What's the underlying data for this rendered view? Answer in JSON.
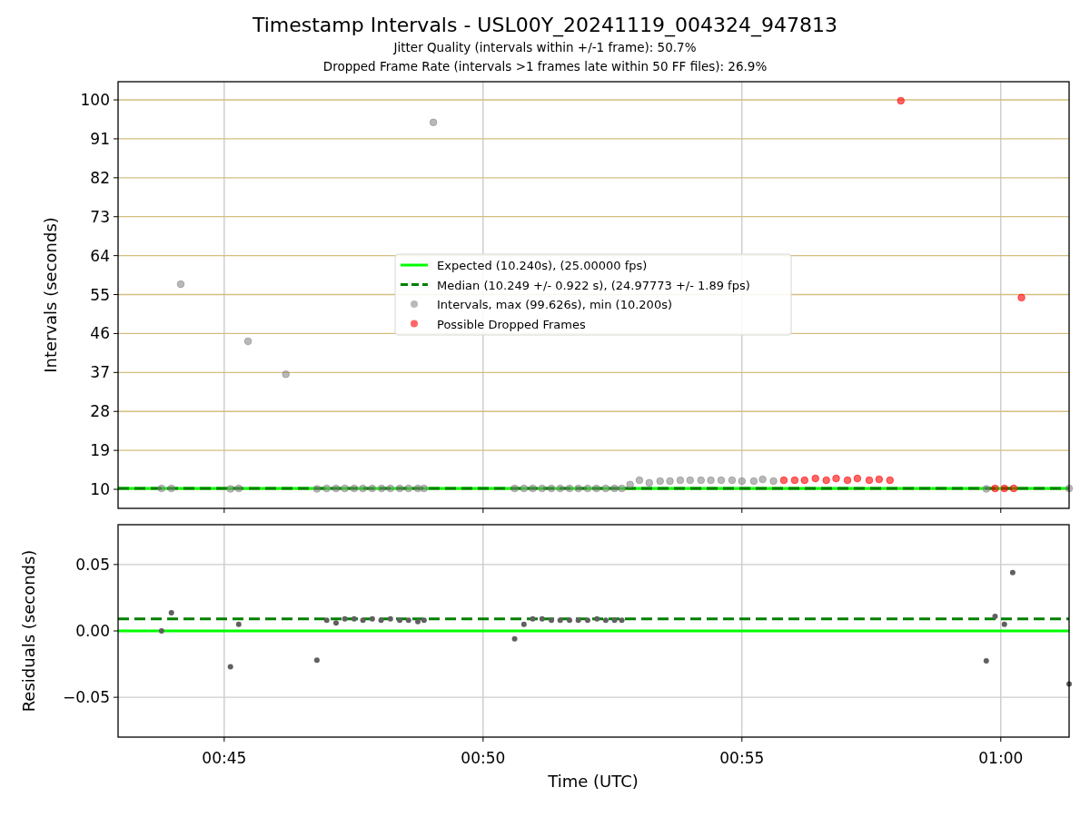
{
  "figure": {
    "title": "Timestamp Intervals - USL00Y_20241119_004324_947813",
    "subtitles": [
      "Jitter Quality (intervals within +/-1 frame): 50.7%",
      "Dropped Frame Rate (intervals >1 frames late within 50 FF files): 26.9%"
    ]
  },
  "charts": [
    {
      "chart_data": {
        "type": "scatter",
        "ylabel": "Intervals (seconds)",
        "xlim": [
          42.95,
          61.32
        ],
        "ylim": [
          5.6,
          104.2
        ],
        "grid": true,
        "legend": "center",
        "yticks": [
          {
            "value": 10,
            "label": "10"
          },
          {
            "value": 19,
            "label": "19"
          },
          {
            "value": 28,
            "label": "28"
          },
          {
            "value": 37,
            "label": "37"
          },
          {
            "value": 46,
            "label": "46"
          },
          {
            "value": 55,
            "label": "55"
          },
          {
            "value": 64,
            "label": "64"
          },
          {
            "value": 73,
            "label": "73"
          },
          {
            "value": 82,
            "label": "82"
          },
          {
            "value": 91,
            "label": "91"
          },
          {
            "value": 100,
            "label": "100"
          }
        ],
        "series": [
          {
            "name": "Expected (10.240s), (25.00000 fps)",
            "type": "line",
            "line_style": "solid",
            "color": "#00ff00",
            "x": [
              42.95,
              61.32
            ],
            "values": [
              10.2,
              10.2
            ]
          },
          {
            "name": "Median (10.249 +/- 0.922 s), (24.97773 +/- 1.89 fps)",
            "type": "line",
            "line_style": "dashed",
            "color": "#008000",
            "x": [
              42.95,
              61.32
            ],
            "values": [
              10.2,
              10.2
            ]
          },
          {
            "name": "Intervals, max (99.626s), min (10.200s)",
            "type": "scatter",
            "color": "#808080",
            "x": [
              43.79,
              43.98,
              44.16,
              45.12,
              45.28,
              45.46,
              46.19,
              46.79,
              46.98,
              47.16,
              47.33,
              47.51,
              47.68,
              47.86,
              48.04,
              48.21,
              48.39,
              48.56,
              48.74,
              48.86,
              49.04,
              50.61,
              50.79,
              50.96,
              51.14,
              51.32,
              51.49,
              51.67,
              51.84,
              52.02,
              52.19,
              52.37,
              52.54,
              52.68,
              52.84,
              53.02,
              53.21,
              53.42,
              53.61,
              53.81,
              54.0,
              54.21,
              54.4,
              54.6,
              54.81,
              55.0,
              55.23,
              55.4,
              55.61,
              59.72,
              61.32
            ],
            "values": [
              10.2,
              10.2,
              57.4,
              10.1,
              10.2,
              44.2,
              36.6,
              10.1,
              10.2,
              10.2,
              10.2,
              10.2,
              10.2,
              10.2,
              10.2,
              10.2,
              10.2,
              10.2,
              10.2,
              10.2,
              94.8,
              10.2,
              10.2,
              10.2,
              10.2,
              10.2,
              10.2,
              10.2,
              10.2,
              10.2,
              10.2,
              10.2,
              10.2,
              10.2,
              11.1,
              12.1,
              11.5,
              11.9,
              11.9,
              12.1,
              12.1,
              12.1,
              12.1,
              12.1,
              12.1,
              11.9,
              11.9,
              12.3,
              11.9,
              10.1,
              10.2
            ]
          },
          {
            "name": "Possible Dropped Frames",
            "type": "scatter",
            "color": "#ff0000",
            "x": [
              55.81,
              56.02,
              56.21,
              56.42,
              56.63,
              56.82,
              57.04,
              57.23,
              57.46,
              57.65,
              57.86,
              58.07,
              59.89,
              60.07,
              60.25,
              60.4
            ],
            "values": [
              12.1,
              12.1,
              12.1,
              12.5,
              12.1,
              12.5,
              12.1,
              12.5,
              12.1,
              12.3,
              12.1,
              99.8,
              10.2,
              10.2,
              10.2,
              54.3
            ]
          }
        ]
      }
    },
    {
      "chart_data": {
        "type": "scatter",
        "xlabel": "Time (UTC)",
        "ylabel": "Residuals (seconds)",
        "xlim": [
          42.95,
          61.32
        ],
        "ylim": [
          -0.08,
          0.08
        ],
        "grid": true,
        "xticks": [
          {
            "value": 45,
            "label": "00:45"
          },
          {
            "value": 50,
            "label": "00:50"
          },
          {
            "value": 55,
            "label": "00:55"
          },
          {
            "value": 60,
            "label": "01:00"
          }
        ],
        "yticks": [
          {
            "value": 0.05,
            "label": "0.05"
          },
          {
            "value": 0,
            "label": "0.00"
          },
          {
            "value": -0.05,
            "label": "−0.05"
          }
        ],
        "series": [
          {
            "type": "line",
            "line_style": "solid",
            "color": "#00ff00",
            "x": [
              42.95,
              61.32
            ],
            "values": [
              0,
              0
            ]
          },
          {
            "type": "line",
            "line_style": "dashed",
            "color": "#008000",
            "x": [
              42.95,
              61.32
            ],
            "values": [
              0.009,
              0.009
            ]
          },
          {
            "type": "scatter",
            "color": "#606060",
            "x": [
              43.79,
              43.98,
              45.12,
              45.28,
              46.79,
              46.98,
              47.16,
              47.33,
              47.51,
              47.68,
              47.86,
              48.03,
              48.21,
              48.39,
              48.56,
              48.74,
              48.86,
              50.61,
              50.79,
              50.96,
              51.14,
              51.32,
              51.49,
              51.67,
              51.84,
              52.02,
              52.2,
              52.37,
              52.54,
              52.68,
              59.72,
              59.89,
              60.07,
              60.23,
              61.32
            ],
            "values": [
              0,
              0.0137,
              -0.027,
              0.005,
              -0.022,
              0.008,
              0.006,
              0.009,
              0.009,
              0.008,
              0.009,
              0.008,
              0.009,
              0.008,
              0.008,
              0.007,
              0.008,
              -0.006,
              0.005,
              0.009,
              0.009,
              0.008,
              0.008,
              0.008,
              0.008,
              0.008,
              0.009,
              0.008,
              0.008,
              0.008,
              -0.0226,
              0.011,
              0.005,
              0.044,
              -0.04
            ]
          }
        ]
      }
    }
  ]
}
